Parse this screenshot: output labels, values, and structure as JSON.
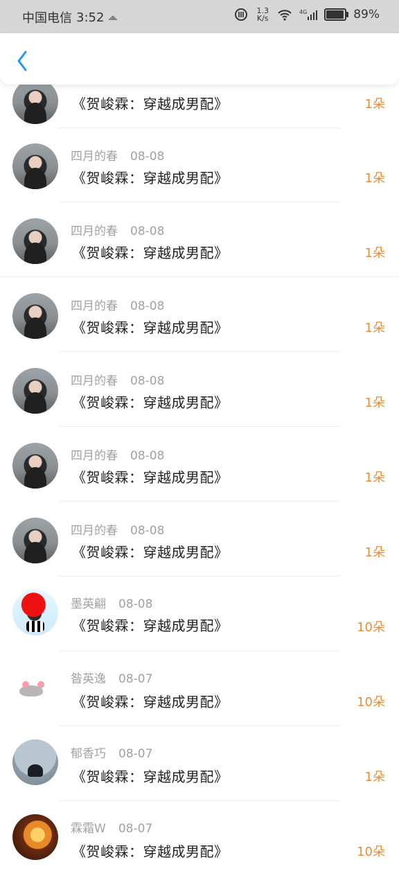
{
  "status_bar": {
    "carrier": "中国电信",
    "time": "3:52",
    "net_speed_top": "1.3",
    "net_speed_unit": "K/s",
    "network": "4G",
    "battery_percent": "89%",
    "battery_level": 0.89
  },
  "header": {
    "back_icon": "chevron-left-icon",
    "accent": "#2196f3"
  },
  "list": {
    "items": [
      {
        "avatar": "girl",
        "name": "",
        "date": "",
        "title": "《贺峻霖：穿越成男配》",
        "amount": "1朵"
      },
      {
        "avatar": "girl",
        "name": "四月的春",
        "date": "08-08",
        "title": "《贺峻霖：穿越成男配》",
        "amount": "1朵"
      },
      {
        "avatar": "girl",
        "name": "四月的春",
        "date": "08-08",
        "title": "《贺峻霖：穿越成男配》",
        "amount": "1朵"
      },
      {
        "avatar": "girl",
        "name": "四月的春",
        "date": "08-08",
        "title": "《贺峻霖：穿越成男配》",
        "amount": "1朵"
      },
      {
        "avatar": "girl",
        "name": "四月的春",
        "date": "08-08",
        "title": "《贺峻霖：穿越成男配》",
        "amount": "1朵"
      },
      {
        "avatar": "girl",
        "name": "四月的春",
        "date": "08-08",
        "title": "《贺峻霖：穿越成男配》",
        "amount": "1朵"
      },
      {
        "avatar": "girl",
        "name": "四月的春",
        "date": "08-08",
        "title": "《贺峻霖：穿越成男配》",
        "amount": "1朵"
      },
      {
        "avatar": "mascot",
        "name": "墨英翩",
        "date": "08-08",
        "title": "《贺峻霖：穿越成男配》",
        "amount": "10朵"
      },
      {
        "avatar": "cat",
        "name": "昝英逸",
        "date": "08-07",
        "title": "《贺峻霖：穿越成男配》",
        "amount": "10朵"
      },
      {
        "avatar": "silhouette",
        "name": "郁香巧",
        "date": "08-07",
        "title": "《贺峻霖：穿越成男配》",
        "amount": "1朵"
      },
      {
        "avatar": "fire",
        "name": "霖霜W",
        "date": "08-07",
        "title": "《贺峻霖：穿越成男配》",
        "amount": "10朵"
      }
    ]
  }
}
